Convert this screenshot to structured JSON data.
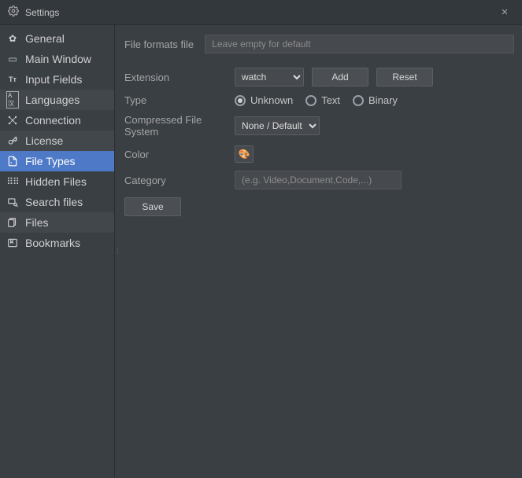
{
  "window": {
    "title": "Settings"
  },
  "sidebar": {
    "items": [
      {
        "label": "General",
        "icon": "gear"
      },
      {
        "label": "Main Window",
        "icon": "window"
      },
      {
        "label": "Input Fields",
        "icon": "text-cursor"
      },
      {
        "label": "Languages",
        "icon": "lang"
      },
      {
        "label": "Connection",
        "icon": "connection"
      },
      {
        "label": "License",
        "icon": "key"
      },
      {
        "label": "File Types",
        "icon": "filetype"
      },
      {
        "label": "Hidden Files",
        "icon": "grid"
      },
      {
        "label": "Search files",
        "icon": "search"
      },
      {
        "label": "Files",
        "icon": "files"
      },
      {
        "label": "Bookmarks",
        "icon": "bookmark"
      }
    ]
  },
  "form": {
    "fileFormats": {
      "label": "File formats file",
      "placeholder": "Leave empty for default",
      "value": ""
    },
    "extension": {
      "label": "Extension",
      "value": "watch",
      "addLabel": "Add",
      "resetLabel": "Reset"
    },
    "type": {
      "label": "Type",
      "options": {
        "unknown": "Unknown",
        "text": "Text",
        "binary": "Binary"
      },
      "selected": "unknown"
    },
    "cfs": {
      "label": "Compressed File System",
      "value": "None / Default"
    },
    "color": {
      "label": "Color"
    },
    "category": {
      "label": "Category",
      "placeholder": "(e.g. Video,Document,Code,...)",
      "value": ""
    },
    "saveLabel": "Save"
  }
}
